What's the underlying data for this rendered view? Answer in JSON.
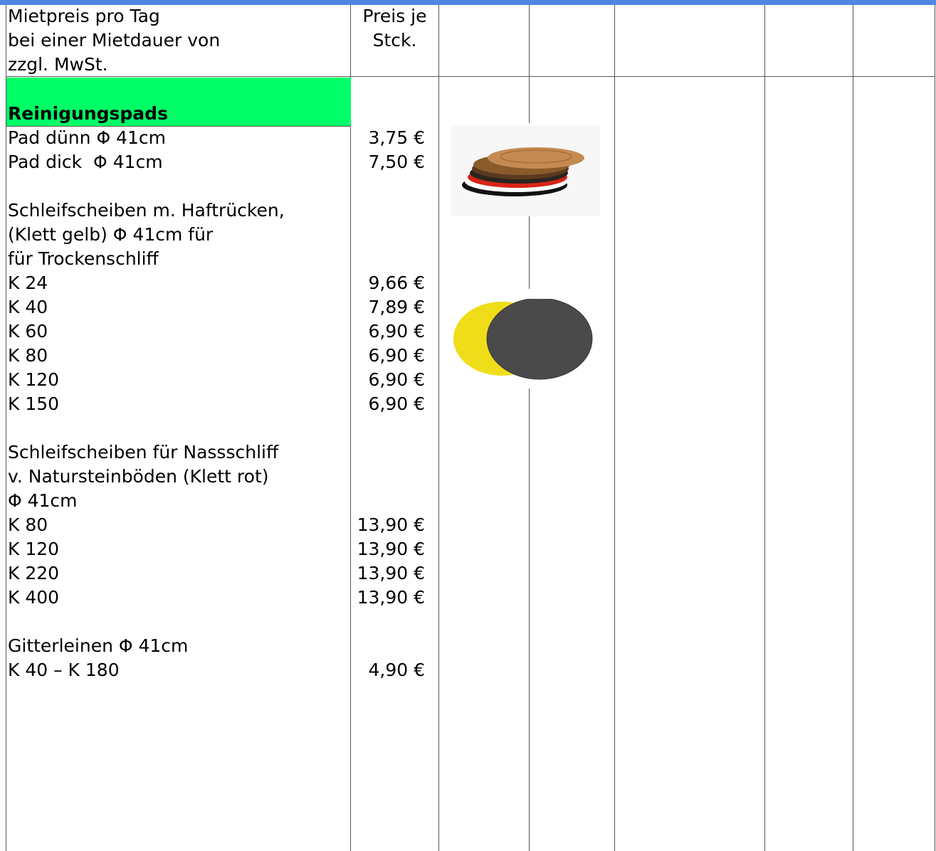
{
  "header": {
    "col1": [
      "Mietpreis pro Tag",
      "bei einer Mietdauer von",
      "zzgl. MwSt."
    ],
    "col2": [
      "Preis je",
      "Stck."
    ]
  },
  "section": {
    "title": "Reinigungspads",
    "color": "#00ff66"
  },
  "rows": [
    {
      "label": "Pad dünn Φ 41cm",
      "price": "3,75 €"
    },
    {
      "label": "Pad dick  Φ 41cm",
      "price": "7,50 €"
    },
    {
      "label": "",
      "price": ""
    },
    {
      "label": "Schleifscheiben m. Haftrücken,",
      "price": ""
    },
    {
      "label": "(Klett gelb) Φ 41cm für",
      "price": ""
    },
    {
      "label": "für Trockenschliff",
      "price": ""
    },
    {
      "label": "K 24",
      "price": "9,66 €"
    },
    {
      "label": "K 40",
      "price": "7,89 €"
    },
    {
      "label": "K 60",
      "price": "6,90 €"
    },
    {
      "label": "K 80",
      "price": "6,90 €"
    },
    {
      "label": "K 120",
      "price": "6,90 €"
    },
    {
      "label": "K 150",
      "price": "6,90 €"
    },
    {
      "label": "",
      "price": ""
    },
    {
      "label": "Schleifscheiben für Nassschliff",
      "price": ""
    },
    {
      "label": "v. Natursteinböden (Klett rot)",
      "price": ""
    },
    {
      "label": "Φ 41cm",
      "price": ""
    },
    {
      "label": "K 80",
      "price": "13,90 €"
    },
    {
      "label": "K 120",
      "price": "13,90 €"
    },
    {
      "label": "K 220",
      "price": "13,90 €"
    },
    {
      "label": "K 400",
      "price": "13,90 €"
    },
    {
      "label": "",
      "price": ""
    },
    {
      "label": "Gitterleinen Φ 41cm",
      "price": ""
    },
    {
      "label": "K 40 – K 180",
      "price": "4,90 €"
    }
  ],
  "images": {
    "pads": "stacked-cleaning-pads-image",
    "discs": "sanding-discs-image"
  }
}
